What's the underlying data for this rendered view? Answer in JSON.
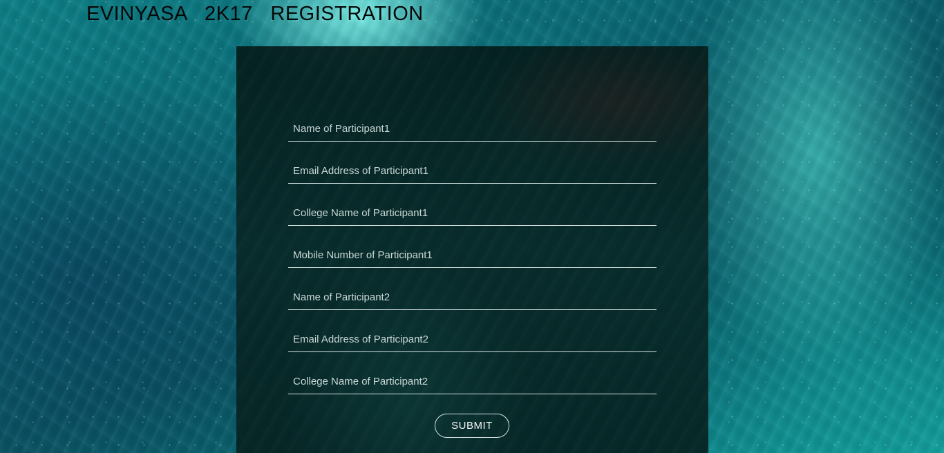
{
  "header": {
    "title": "EVINYASA   2K17   REGISTRATION"
  },
  "form": {
    "fields": [
      {
        "placeholder": "Name of Participant1",
        "value": ""
      },
      {
        "placeholder": "Email Address of Participant1",
        "value": ""
      },
      {
        "placeholder": "College Name of Participant1",
        "value": ""
      },
      {
        "placeholder": "Mobile Number of Participant1",
        "value": ""
      },
      {
        "placeholder": "Name of Participant2",
        "value": ""
      },
      {
        "placeholder": "Email Address of Participant2",
        "value": ""
      },
      {
        "placeholder": "College Name of Participant2",
        "value": ""
      }
    ],
    "submit_label": "SUBMIT"
  },
  "colors": {
    "panel_background": "#062220",
    "field_underline": "#d8e6e4",
    "text": "#e8f2f0",
    "title_text": "#050808",
    "water_accent": "#13a3a0"
  }
}
